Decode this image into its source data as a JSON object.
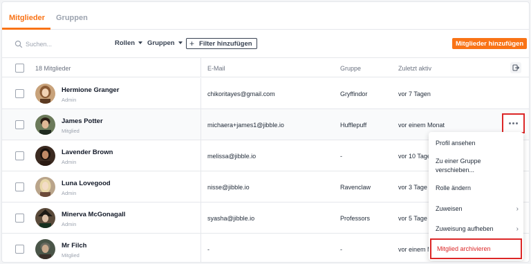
{
  "tabs": [
    {
      "label": "Mitglieder"
    },
    {
      "label": "Gruppen"
    }
  ],
  "toolbar": {
    "search_placeholder": "Suchen...",
    "roles_label": "Rollen",
    "groups_label": "Gruppen",
    "filter_label": "Filter hinzufügen",
    "add_label": "Mitglieder hinzufügen"
  },
  "table": {
    "member_count": "18 Mitglieder",
    "headers": {
      "email": "E-Mail",
      "group": "Gruppe",
      "last_active": "Zuletzt aktiv"
    },
    "rows": [
      {
        "name": "Hermione Granger",
        "role": "Admin",
        "email": "chikoritayes@gmail.com",
        "group": "Gryffindor",
        "last_active": "vor 7 Tagen"
      },
      {
        "name": "James Potter",
        "role": "Mitglied",
        "email": "michaera+james1@jibble.io",
        "group": "Hufflepuff",
        "last_active": "vor einem Monat"
      },
      {
        "name": "Lavender Brown",
        "role": "Admin",
        "email": "melissa@jibble.io",
        "group": "-",
        "last_active": "vor 10 Tage"
      },
      {
        "name": "Luna Lovegood",
        "role": "Admin",
        "email": "nisse@jibble.io",
        "group": "Ravenclaw",
        "last_active": "vor 3 Tage"
      },
      {
        "name": "Minerva McGonagall",
        "role": "Admin",
        "email": "syasha@jibble.io",
        "group": "Professors",
        "last_active": "vor 5 Tage"
      },
      {
        "name": "Mr Filch",
        "role": "Mitglied",
        "email": "-",
        "group": "-",
        "last_active": "vor einem M"
      }
    ]
  },
  "menu": {
    "items": [
      {
        "label": "Profil ansehen"
      },
      {
        "label": "Zu einer Gruppe verschieben..."
      },
      {
        "label": "Rolle ändern"
      },
      {
        "label": "Zuweisen"
      },
      {
        "label": "Zuweisung aufheben"
      }
    ],
    "archive_label": "Mitglied archivieren"
  },
  "colors": {
    "accent": "#f97316",
    "highlight": "#dc2626"
  }
}
